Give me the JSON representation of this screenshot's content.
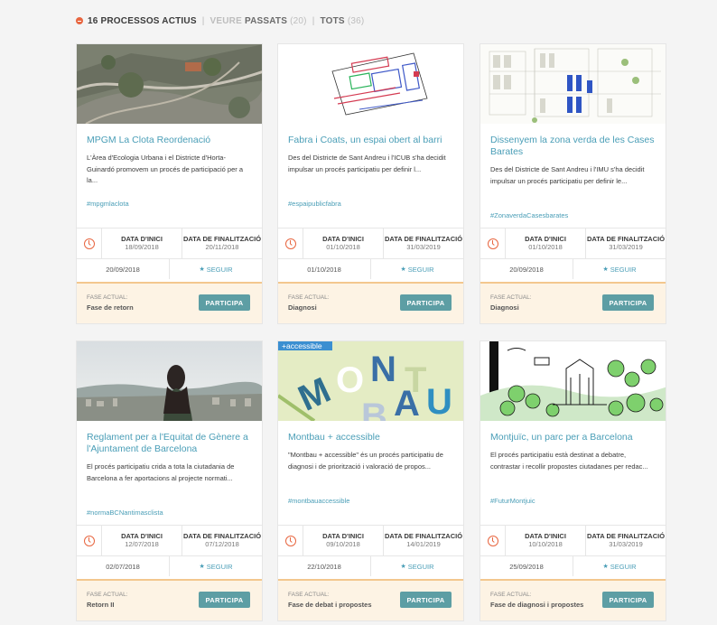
{
  "filters": {
    "active_count": "16",
    "active_label": "Processos actius",
    "view_label": "VEURE",
    "past_label": "PASSATS",
    "past_count": "(20)",
    "all_label": "TOTS",
    "all_count": "(36)"
  },
  "labels": {
    "start": "DATA D'INICI",
    "end": "DATA DE FINALITZACIÓ",
    "follow": "SEGUIR",
    "phase": "FASE ACTUAL:",
    "participate": "PARTICIPA"
  },
  "cards": [
    {
      "title": "MPGM La Clota Reordenació",
      "description": "L'Àrea d'Ecologia Urbana i el Districte d'Horta-Guinardó promovem un procés de participació per a la...",
      "tag": "#mpgmlaclota",
      "start_date": "18/09/2018",
      "end_date": "20/11/2018",
      "published": "20/09/2018",
      "phase": "Fase de retorn",
      "image": "aerial-city-photo"
    },
    {
      "title": "Fabra i Coats, un espai obert al barri",
      "description": "Des del Districte de Sant Andreu i l'ICUB s'ha decidit impulsar un procés participatiu per definir l...",
      "tag": "#espaipublicfabra",
      "start_date": "01/10/2018",
      "end_date": "31/03/2019",
      "published": "01/10/2018",
      "phase": "Diagnosi",
      "image": "site-plan-drawing"
    },
    {
      "title": "Dissenyem la zona verda de les Cases Barates",
      "description": "Des del Districte de Sant Andreu i l'IMU s'ha decidit impulsar un procés participatiu per definir le...",
      "tag": "#ZonaverdaCasesbarates",
      "start_date": "01/10/2018",
      "end_date": "31/03/2019",
      "published": "20/09/2018",
      "phase": "Diagnosi",
      "image": "block-plan-drawing"
    },
    {
      "title": "Reglament per a l'Equitat de Gènere a l'Ajuntament de Barcelona",
      "description": "El procés participatiu crida a tota la ciutadania de Barcelona a fer aportacions al projecte normati...",
      "tag": "#normaBCNantimasclista",
      "start_date": "12/07/2018",
      "end_date": "07/12/2018",
      "published": "02/07/2018",
      "phase": "Retorn II",
      "image": "woman-overlooking-city-photo"
    },
    {
      "title": "Montbau + accessible",
      "description": "\"Montbau + accessible\" és un procés participatiu de diagnosi i de priorització i valoració de propos...",
      "tag": "#montbauaccessible",
      "start_date": "09/10/2018",
      "end_date": "14/01/2019",
      "published": "22/10/2018",
      "phase": "Fase de debat i propostes",
      "image": "montbau-lettering-graphic",
      "badge": "+accessible",
      "graphic_text": "MONTBAU"
    },
    {
      "title": "Montjuïc, un parc per a Barcelona",
      "description": "El procés participatiu està destinat a debatre, contrastar i recollir propostes ciutadanes per redac...",
      "tag": "#FuturMontjuic",
      "start_date": "10/10/2018",
      "end_date": "31/03/2019",
      "published": "25/09/2018",
      "phase": "Fase de diagnosi i propostes",
      "image": "park-illustration"
    }
  ],
  "colors": {
    "accent_link": "#4a9eb7",
    "button": "#5d9ea4",
    "alert": "#e86640",
    "phase_bg": "#fdf3e4",
    "phase_border": "#f3c78e"
  }
}
